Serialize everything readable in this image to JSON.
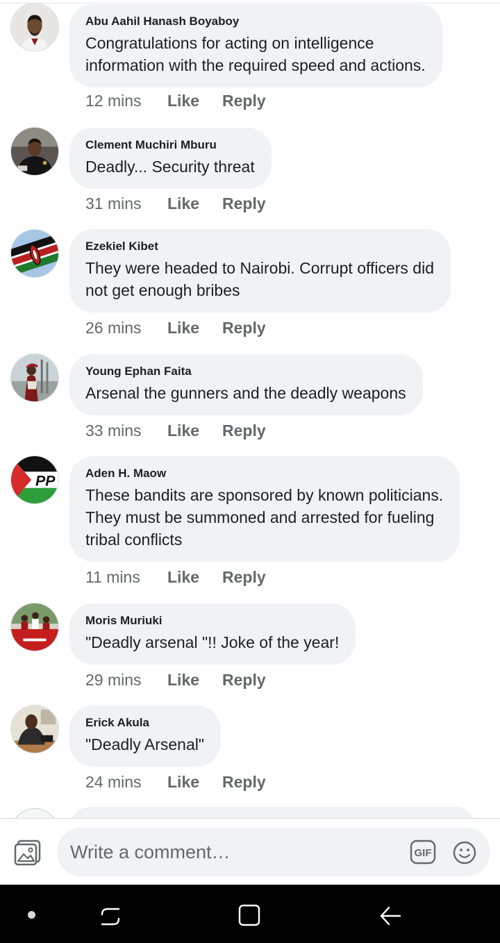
{
  "comments": [
    {
      "author": "Abu Aahil Hanash Boyaboy",
      "lines": [
        "Congratulations for acting on intelligence",
        "information with the required speed and actions."
      ],
      "time": "12 mins",
      "like": "Like",
      "reply": "Reply",
      "avatar": "man-portrait"
    },
    {
      "author": "Clement Muchiri Mburu",
      "lines": [
        "Deadly... Security threat"
      ],
      "time": "31 mins",
      "like": "Like",
      "reply": "Reply",
      "avatar": "man-dark-shirt"
    },
    {
      "author": "Ezekiel Kibet",
      "lines": [
        "They were headed to Nairobi. Corrupt officers did",
        "not get enough bribes"
      ],
      "time": "26 mins",
      "like": "Like",
      "reply": "Reply",
      "avatar": "kenya-flag"
    },
    {
      "author": "Young Ephan Faita",
      "lines": [
        "Arsenal the gunners and the deadly weapons"
      ],
      "time": "33 mins",
      "like": "Like",
      "reply": "Reply",
      "avatar": "person-outdoors"
    },
    {
      "author": "Aden H. Maow",
      "lines": [
        "These bandits are sponsored by known politicians.",
        "They must be summoned and arrested for fueling",
        "tribal conflicts"
      ],
      "time": "11 mins",
      "like": "Like",
      "reply": "Reply",
      "avatar": "party-flag-logo",
      "avatar_logo_text": "PP"
    },
    {
      "author": "Moris Muriuki",
      "lines": [
        "\"Deadly arsenal \"!! Joke of the year!"
      ],
      "time": "29 mins",
      "like": "Like",
      "reply": "Reply",
      "avatar": "group-photo-red"
    },
    {
      "author": "Erick Akula",
      "lines": [
        "\"Deadly Arsenal\""
      ],
      "time": "24 mins",
      "like": "Like",
      "reply": "Reply",
      "avatar": "man-at-desk"
    }
  ],
  "composer": {
    "placeholder": "Write a comment…",
    "photo_icon": "photo-gallery-icon",
    "gif_icon": "gif-icon",
    "gif_label": "GIF",
    "emoji_icon": "emoji-icon"
  },
  "navbar": {
    "items": [
      "menu-dot-icon",
      "recents-icon",
      "home-icon",
      "back-icon"
    ]
  },
  "colors": {
    "bubble": "#f0f2f5",
    "meta_text": "#65676b",
    "primary_text": "#1c1e21",
    "navbar": "#000000"
  }
}
